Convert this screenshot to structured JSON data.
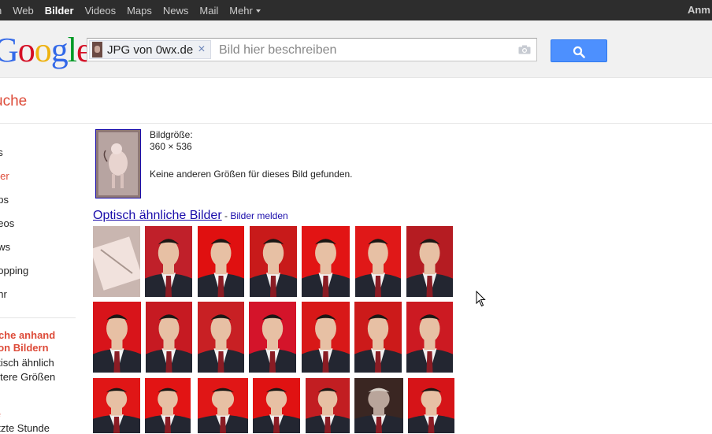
{
  "topbar": {
    "nav": [
      "h",
      "Web",
      "Bilder",
      "Videos",
      "Maps",
      "News",
      "Mail",
      "Mehr"
    ],
    "active": "Bilder",
    "signin": "Anm"
  },
  "header": {
    "logo": "Google",
    "chip_label": "JPG von 0wx.de",
    "chip_close": "×",
    "search_placeholder": "Bild hier beschreiben"
  },
  "title": "uche",
  "leftnav": {
    "items": [
      "es",
      "lder",
      "aps",
      "deos",
      "ews",
      "hopping",
      "ehr"
    ],
    "active_index": 1,
    "section1_title_line1": "uche anhand",
    "section1_title_line2": "von Bildern",
    "section1_items": [
      "ptisch ähnlich",
      "eitere Größen"
    ],
    "section2_title": "le",
    "section2_item": "etzte Stunde"
  },
  "result": {
    "size_label": "Bildgröße:",
    "size_value": "360 × 536",
    "no_other_sizes": "Keine anderen Größen für dieses Bild gefunden."
  },
  "similar": {
    "title": "Optisch ähnliche Bilder",
    "separator": " - ",
    "report_link": "Bilder melden"
  },
  "colors": {
    "accent_red": "#dd4b39",
    "link_blue": "#1a0dab",
    "search_blue": "#4d90fe",
    "topbar_bg": "#2d2d2d"
  },
  "icons": {
    "search": "search-icon",
    "camera": "camera-icon",
    "close": "close-icon",
    "cursor": "mouse-cursor-icon"
  }
}
